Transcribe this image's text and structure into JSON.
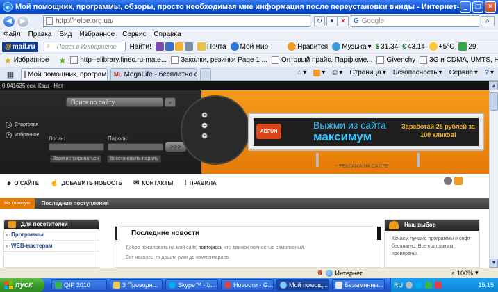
{
  "window": {
    "title": "Мой помощник, программы, обзоры, просто необходимая мне информация после переустановки винды - Интернет-магазин www.3gtel.dp.ua",
    "min": "_",
    "max": "□",
    "close": "✕"
  },
  "address": {
    "url": "http://helpe.org.ua/",
    "search_placeholder": "Google"
  },
  "menu": [
    "Файл",
    "Правка",
    "Вид",
    "Избранное",
    "Сервис",
    "Справка"
  ],
  "mailru_bar": {
    "logo": "mail.ru",
    "search_placeholder": "Поиск в Интернете",
    "find": "Найти!",
    "mail": "Почта",
    "myworld": "Мой мир",
    "like": "Нравится",
    "music": "Музыка",
    "usd": "31.34",
    "eur": "43.14",
    "weather": "+5°C",
    "count": "29"
  },
  "favorites": {
    "label": "Избранное",
    "items": [
      "http--elibrary.finec.ru-mate...",
      "Заколки, резинки Page 1 ...",
      "Оптовый прайс. Парфюме...",
      "Givenchy",
      "3G и CDMA, UMTS, HSDPA, ..."
    ]
  },
  "tabs": {
    "active": "Мой помощник, програм...",
    "inactive": "MegaLife - бесплатно скача..."
  },
  "commands": {
    "page": "Страница",
    "safety": "Безопасность",
    "service": "Сервис"
  },
  "site": {
    "topline": "0.041635 сек. Кэш - Нет",
    "search_placeholder": "Поиск по сайту",
    "links": [
      "Стартовая",
      "Избранное"
    ],
    "login_label": "Логин:",
    "password_label": "Пароль:",
    "login_go": ">>>",
    "register": "Зарегистрироваться",
    "restore": "Восстановить пароль",
    "ad": {
      "badge": "ADFUN",
      "line1": "Выжми из сайта",
      "line2": "максимум",
      "right": "Заработай 25 рублей за 100 кликов!",
      "caption": "РЕКЛАМА НА САЙТЕ"
    },
    "nav": [
      "О САЙТЕ",
      "ДОБАВИТЬ НОВОСТЬ",
      "КОНТАКТЫ",
      "ПРАВИЛА"
    ],
    "breadcrumb_home": "На главную",
    "breadcrumb_current": "Последние поступления",
    "left_box": {
      "title": "Для посетителей",
      "items": [
        "Программы",
        "WEB-мастерам"
      ]
    },
    "center_box": {
      "title": "Последние новости",
      "line1_pre": "Добро пожаловать на мой сайт,",
      "line1_link": "повторюсь",
      "line1_post": "что движок полностью самописный.",
      "line2": "Вот наконец-то дошли руки до комментариев."
    },
    "right_box": {
      "title": "Наш выбор",
      "text": "Качаем лучшие программы и софт бесплатно. Все программы проверены."
    }
  },
  "status": {
    "zone": "Интернет",
    "zoom": "100%"
  },
  "taskbar": {
    "start": "пуск",
    "tasks": [
      "QIP 2010",
      "3 Проводн...",
      "Skype™ - b...",
      "Новости - G...",
      "Мой помощ...",
      "Безымянны..."
    ],
    "lang": "RU",
    "clock": "15:15"
  },
  "colors": {
    "xp_blue": "#245edb",
    "site_orange": "#f08a10",
    "start_green": "#3a9a2a"
  }
}
